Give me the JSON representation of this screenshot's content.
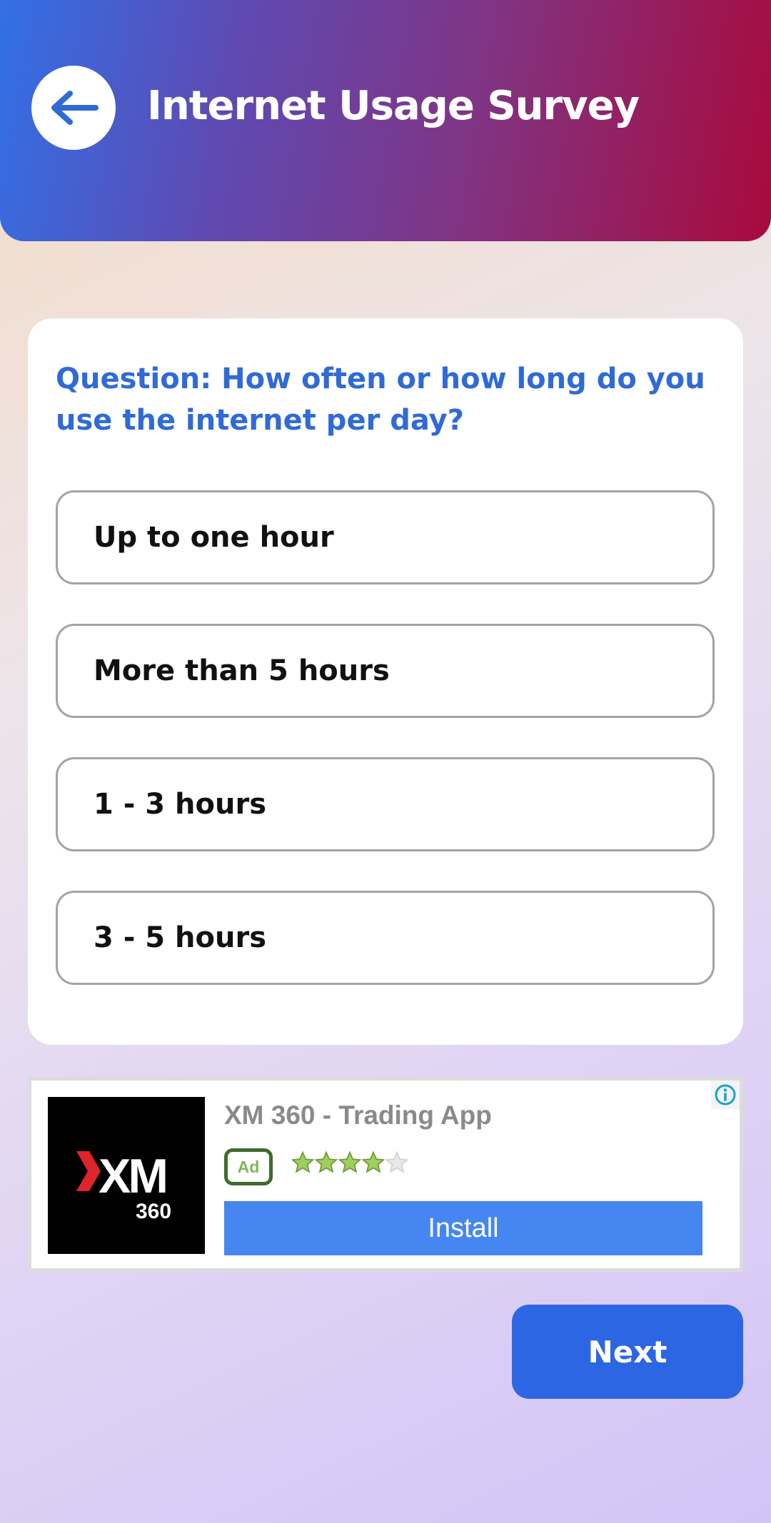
{
  "header": {
    "title": "Internet Usage Survey",
    "back_icon": "arrow-left-icon"
  },
  "survey": {
    "question": "Question: How often or how long do you use the internet per day?",
    "options": [
      "Up to one hour",
      "More than 5 hours",
      "1 - 3 hours",
      "3 - 5 hours"
    ]
  },
  "ad": {
    "title": "XM 360 - Trading App",
    "badge": "Ad",
    "logo_text": "XM",
    "logo_subtext": "360",
    "rating": 4,
    "rating_max": 5,
    "install_label": "Install",
    "info_icon": "info-icon"
  },
  "footer": {
    "next_label": "Next"
  },
  "colors": {
    "accent": "#2c66e3",
    "question": "#2f6ad7",
    "header_start": "#3270e6",
    "header_end": "#a90a3c",
    "install": "#4686f0"
  }
}
